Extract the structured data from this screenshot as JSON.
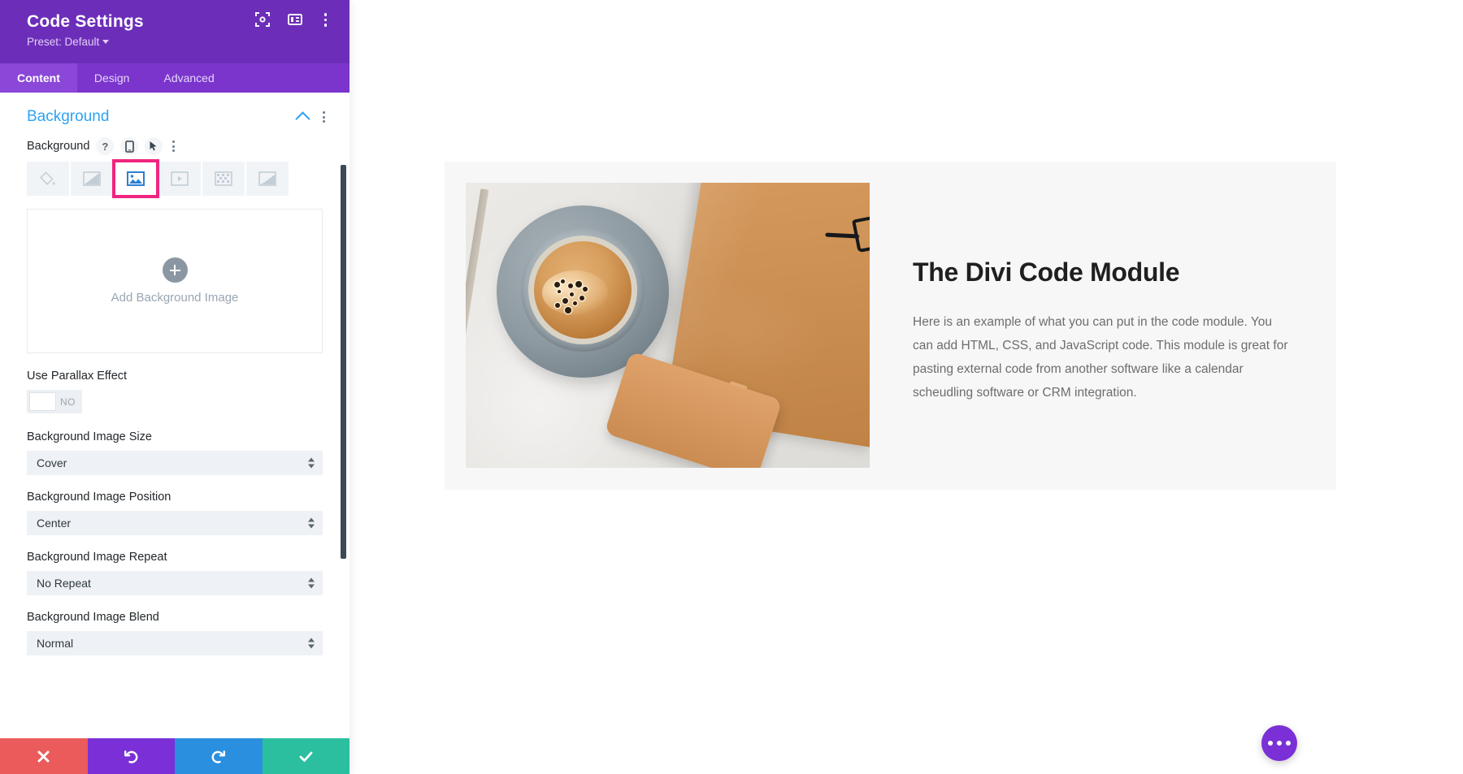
{
  "panel": {
    "title": "Code Settings",
    "preset_label": "Preset: Default",
    "header_icons": [
      {
        "name": "focus-frame-icon"
      },
      {
        "name": "layout-panel-icon"
      },
      {
        "name": "more-vertical-icon"
      }
    ],
    "tabs": [
      {
        "label": "Content",
        "active": true
      },
      {
        "label": "Design",
        "active": false
      },
      {
        "label": "Advanced",
        "active": false
      }
    ],
    "section": {
      "title": "Background",
      "collapse_icon": "chevron-up-icon",
      "options_icon": "more-vertical-icon"
    },
    "background_field": {
      "label": "Background",
      "help_icon": "question-mark-icon",
      "responsive_icon": "mobile-device-icon",
      "hover_icon": "cursor-pointer-icon",
      "more_icon": "more-vertical-icon",
      "types": [
        {
          "name": "background-color-tab",
          "icon": "paint-bucket-icon",
          "active": false
        },
        {
          "name": "background-gradient-tab",
          "icon": "gradient-icon",
          "active": false
        },
        {
          "name": "background-image-tab",
          "icon": "image-icon",
          "active": true
        },
        {
          "name": "background-video-tab",
          "icon": "video-icon",
          "active": false
        },
        {
          "name": "background-pattern-tab",
          "icon": "pattern-icon",
          "active": false
        },
        {
          "name": "background-mask-tab",
          "icon": "mask-icon",
          "active": false
        }
      ],
      "highlight_color": "#f0257f",
      "active_icon_color": "#2ea3f2"
    },
    "dropzone": {
      "label": "Add Background Image",
      "add_icon": "plus-circle-icon"
    },
    "controls": [
      {
        "label": "Use Parallax Effect",
        "type": "toggle",
        "value": "NO"
      },
      {
        "label": "Background Image Size",
        "type": "select",
        "value": "Cover"
      },
      {
        "label": "Background Image Position",
        "type": "select",
        "value": "Center"
      },
      {
        "label": "Background Image Repeat",
        "type": "select",
        "value": "No Repeat"
      },
      {
        "label": "Background Image Blend",
        "type": "select",
        "value": "Normal"
      }
    ],
    "actions": [
      {
        "name": "cancel-button",
        "icon": "close-icon",
        "color": "#eb5b5b"
      },
      {
        "name": "undo-button",
        "icon": "undo-icon",
        "color": "#7a30d6"
      },
      {
        "name": "redo-button",
        "icon": "redo-icon",
        "color": "#2a8fde"
      },
      {
        "name": "save-button",
        "icon": "check-icon",
        "color": "#2bbfa0"
      }
    ],
    "colors": {
      "header_bg": "#6c2eb9",
      "tabs_bg": "#7b35cc",
      "tab_active_bg": "#8b47d8",
      "section_title": "#2ea3f2"
    }
  },
  "preview": {
    "image_alt": "coffee-cup-notebook-glasses-phone-flatlay",
    "heading": "The Divi Code Module",
    "body": "Here is an example of what you can put in the code module. You can add HTML, CSS, and JavaScript code. This module is great for pasting external code from another software like a calendar scheudling software or CRM integration.",
    "fab": {
      "name": "page-settings-fab",
      "icon": "ellipsis-icon",
      "color": "#7a30d6"
    }
  }
}
